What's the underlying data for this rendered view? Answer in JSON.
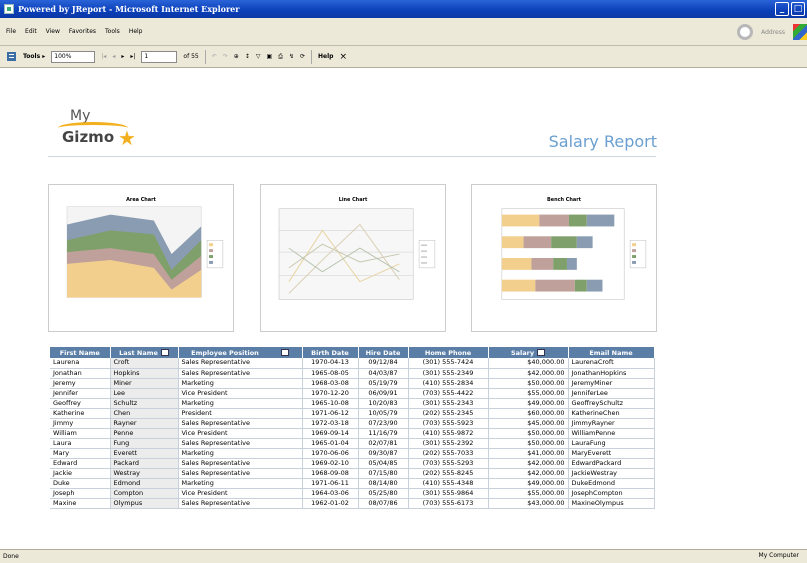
{
  "window": {
    "title": "Powered by JReport - Microsoft Internet Explorer"
  },
  "menu": {
    "items": [
      "File",
      "Edit",
      "View",
      "Favorites",
      "Tools",
      "Help"
    ],
    "address_label": "Address"
  },
  "toolbar": {
    "tools_label": "Tools ▸",
    "zoom": "100%",
    "page_current": "1",
    "page_total": "of 55",
    "help_label": "Help",
    "close_label": "×"
  },
  "report": {
    "logo_my": "My",
    "logo_gizmo": "Gizmo",
    "title": "Salary Report",
    "charts": [
      {
        "title": "Area Chart"
      },
      {
        "title": "Line Chart"
      },
      {
        "title": "Bench Chart"
      }
    ],
    "table": {
      "headers": [
        "First Name",
        "Last Name",
        "Employee Position",
        "Birth Date",
        "Hire Date",
        "Home Phone",
        "Salary",
        "Email Name"
      ],
      "rows": [
        [
          "Laurena",
          "Croft",
          "Sales Representative",
          "1970-04-13",
          "09/12/84",
          "(301) 555-7424",
          "$40,000.00",
          "LaurenaCroft"
        ],
        [
          "Jonathan",
          "Hopkins",
          "Sales Representative",
          "1965-08-05",
          "04/03/87",
          "(301) 555-2349",
          "$42,000.00",
          "JonathanHopkins"
        ],
        [
          "Jeremy",
          "Miner",
          "Marketing",
          "1968-03-08",
          "05/19/79",
          "(410) 555-2834",
          "$50,000.00",
          "JeremyMiner"
        ],
        [
          "Jennifer",
          "Lee",
          "Vice President",
          "1970-12-20",
          "06/09/91",
          "(703) 555-4422",
          "$55,000.00",
          "JenniferLee"
        ],
        [
          "Geoffrey",
          "Schultz",
          "Marketing",
          "1965-10-08",
          "10/20/83",
          "(301) 555-2343",
          "$49,000.00",
          "GeoffreySchultz"
        ],
        [
          "Katherine",
          "Chen",
          "President",
          "1971-06-12",
          "10/05/79",
          "(202) 555-2345",
          "$60,000.00",
          "KatherineChen"
        ],
        [
          "Jimmy",
          "Rayner",
          "Sales Representative",
          "1972-03-18",
          "07/23/90",
          "(703) 555-5923",
          "$45,000.00",
          "JimmyRayner"
        ],
        [
          "William",
          "Penne",
          "Vice President",
          "1969-09-14",
          "11/16/79",
          "(410) 555-9872",
          "$50,000.00",
          "WilliamPenne"
        ],
        [
          "Laura",
          "Fung",
          "Sales Representative",
          "1965-01-04",
          "02/07/81",
          "(301) 555-2392",
          "$50,000.00",
          "LauraFung"
        ],
        [
          "Mary",
          "Everett",
          "Marketing",
          "1970-06-06",
          "09/30/87",
          "(202) 555-7033",
          "$41,000.00",
          "MaryEverett"
        ],
        [
          "Edward",
          "Packard",
          "Sales Representative",
          "1969-02-10",
          "05/04/85",
          "(703) 555-5293",
          "$42,000.00",
          "EdwardPackard"
        ],
        [
          "Jackie",
          "Westray",
          "Sales Representative",
          "1968-09-08",
          "07/15/80",
          "(202) 555-8245",
          "$42,000.00",
          "JackieWestray"
        ],
        [
          "Duke",
          "Edmond",
          "Marketing",
          "1971-06-11",
          "08/14/80",
          "(410) 555-4348",
          "$49,000.00",
          "DukeEdmond"
        ],
        [
          "Joseph",
          "Compton",
          "Vice President",
          "1964-03-06",
          "05/25/80",
          "(301) 555-9864",
          "$55,000.00",
          "JosephCompton"
        ],
        [
          "Maxine",
          "Olympus",
          "Sales Representative",
          "1962-01-02",
          "08/07/86",
          "(703) 555-6173",
          "$43,000.00",
          "MaxineOlympus"
        ]
      ]
    }
  },
  "status": {
    "left": "Done",
    "right": "My Computer"
  },
  "colors": {
    "header_blue": "#5b7ea7",
    "title_blue": "#6a9fd0",
    "xp_blue": "#0a3fb8"
  }
}
